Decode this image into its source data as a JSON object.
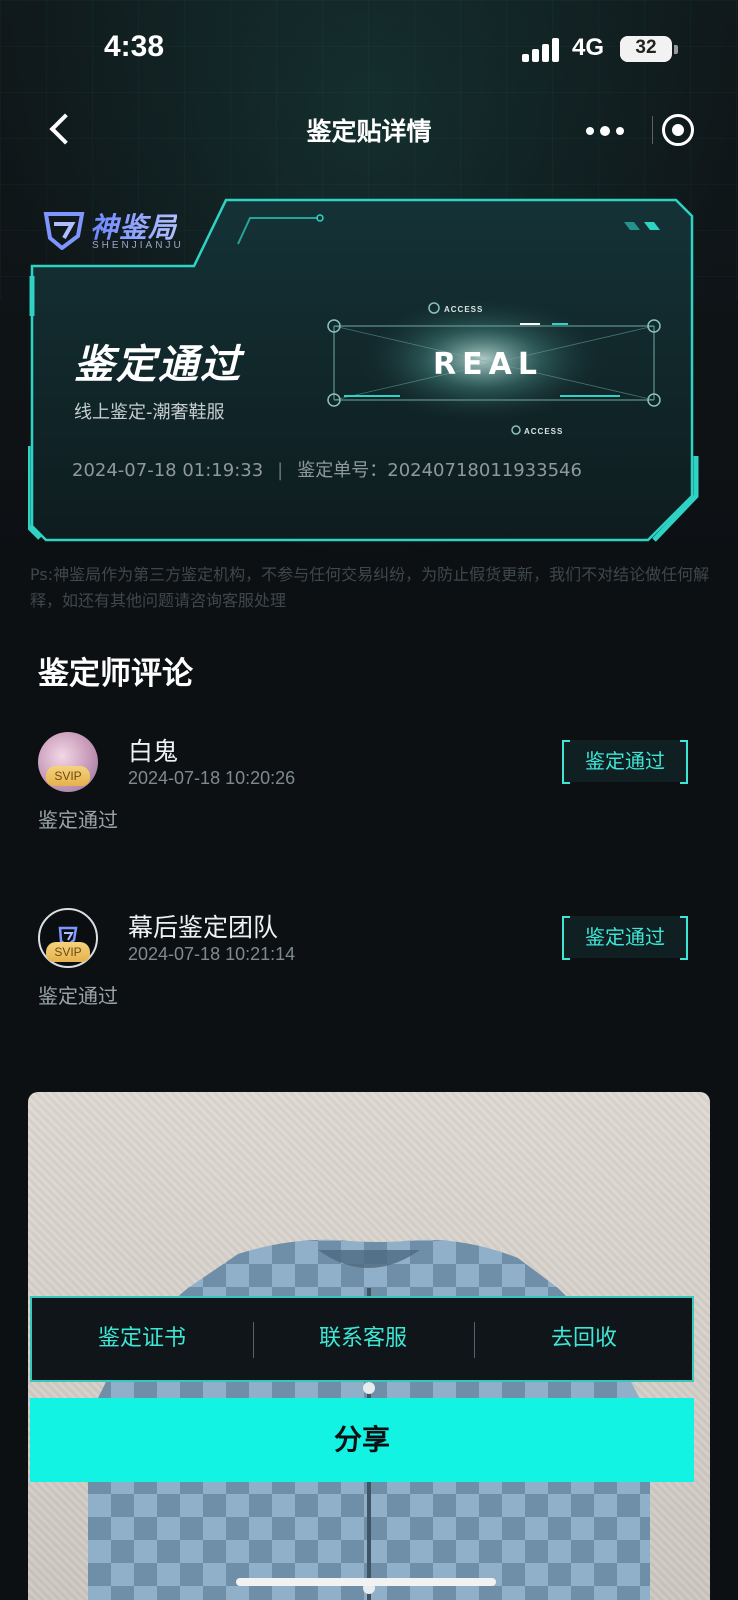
{
  "status_bar": {
    "time": "4:38",
    "network": "4G",
    "battery": "32"
  },
  "nav": {
    "title": "鉴定贴详情"
  },
  "card": {
    "logo_text": "神鉴局",
    "logo_sub": "SHENJIANJU",
    "status": "鉴定通过",
    "subtitle": "线上鉴定-潮奢鞋服",
    "datetime": "2024-07-18 01:19:33",
    "order_label": "鉴定单号：",
    "order_no": "20240718011933546",
    "badge_text": "REAL",
    "badge_access_top": "ACCESS",
    "badge_access_bottom": "ACCESS"
  },
  "disclaimer": "Ps:神鉴局作为第三方鉴定机构，不参与任何交易纠纷，为防止假货更新，我们不对结论做任何解释，如还有其他问题请咨询客服处理",
  "comments_section": {
    "title": "鉴定师评论",
    "items": [
      {
        "name": "白鬼",
        "time": "2024-07-18 10:20:26",
        "badge": "SVIP",
        "tag": "鉴定通过",
        "text": "鉴定通过"
      },
      {
        "name": "幕后鉴定团队",
        "time": "2024-07-18 10:21:14",
        "badge": "SVIP",
        "tag": "鉴定通过",
        "text": "鉴定通过"
      }
    ]
  },
  "actions": {
    "certificate": "鉴定证书",
    "contact": "联系客服",
    "recycle": "去回收",
    "share": "分享"
  },
  "colors": {
    "accent": "#13f3e3",
    "background": "#0d1013",
    "tag_text": "#3ee6d6"
  }
}
